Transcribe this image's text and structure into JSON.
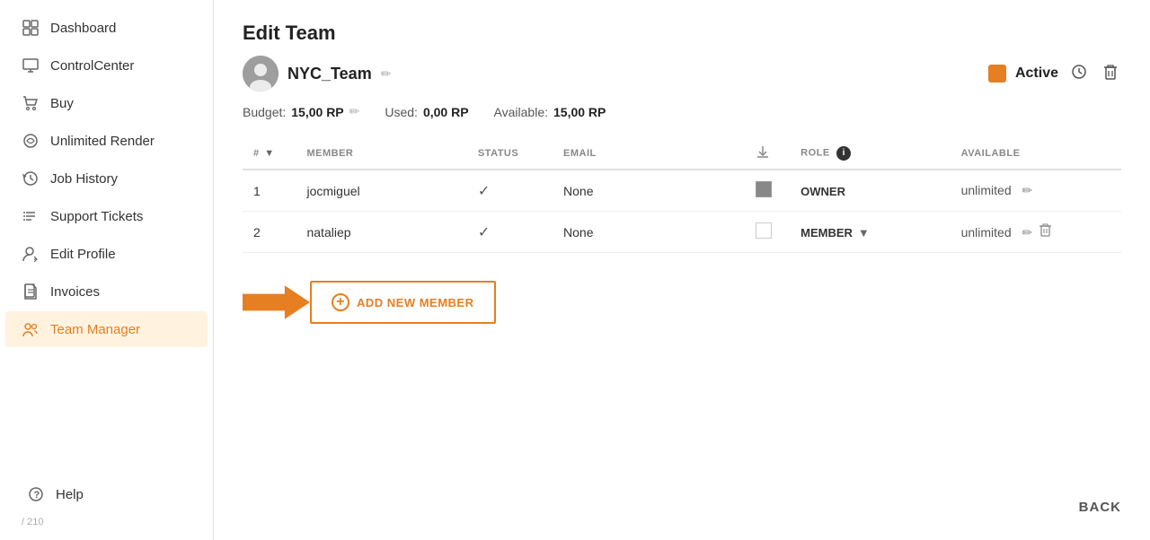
{
  "sidebar": {
    "items": [
      {
        "id": "dashboard",
        "label": "Dashboard",
        "icon": "grid"
      },
      {
        "id": "controlcenter",
        "label": "ControlCenter",
        "icon": "monitor"
      },
      {
        "id": "buy",
        "label": "Buy",
        "icon": "cart"
      },
      {
        "id": "unlimited-render",
        "label": "Unlimited Render",
        "icon": "circle-alt"
      },
      {
        "id": "job-history",
        "label": "Job History",
        "icon": "history"
      },
      {
        "id": "support-tickets",
        "label": "Support Tickets",
        "icon": "list"
      },
      {
        "id": "edit-profile",
        "label": "Edit Profile",
        "icon": "user-edit"
      },
      {
        "id": "invoices",
        "label": "Invoices",
        "icon": "document"
      },
      {
        "id": "team-manager",
        "label": "Team Manager",
        "icon": "team"
      }
    ],
    "bottom": {
      "help_label": "Help"
    }
  },
  "main": {
    "page_title": "Edit Team",
    "team": {
      "name": "NYC_Team",
      "status": "Active",
      "budget_label": "Budget:",
      "budget_value": "15,00 RP",
      "used_label": "Used:",
      "used_value": "0,00 RP",
      "available_label": "Available:",
      "available_value": "15,00 RP"
    },
    "table": {
      "columns": [
        "#",
        "MEMBER",
        "STATUS",
        "EMAIL",
        "",
        "ROLE",
        "AVAILABLE"
      ],
      "rows": [
        {
          "num": "1",
          "member": "jocmiguel",
          "status": "✓",
          "email": "None",
          "color": "filled",
          "role": "OWNER",
          "role_dropdown": false,
          "available": "unlimited"
        },
        {
          "num": "2",
          "member": "nataliep",
          "status": "✓",
          "email": "None",
          "color": "empty",
          "role": "MEMBER",
          "role_dropdown": true,
          "available": "unlimited"
        }
      ]
    },
    "add_member_btn_label": "ADD NEW MEMBER",
    "back_btn_label": "BACK"
  }
}
